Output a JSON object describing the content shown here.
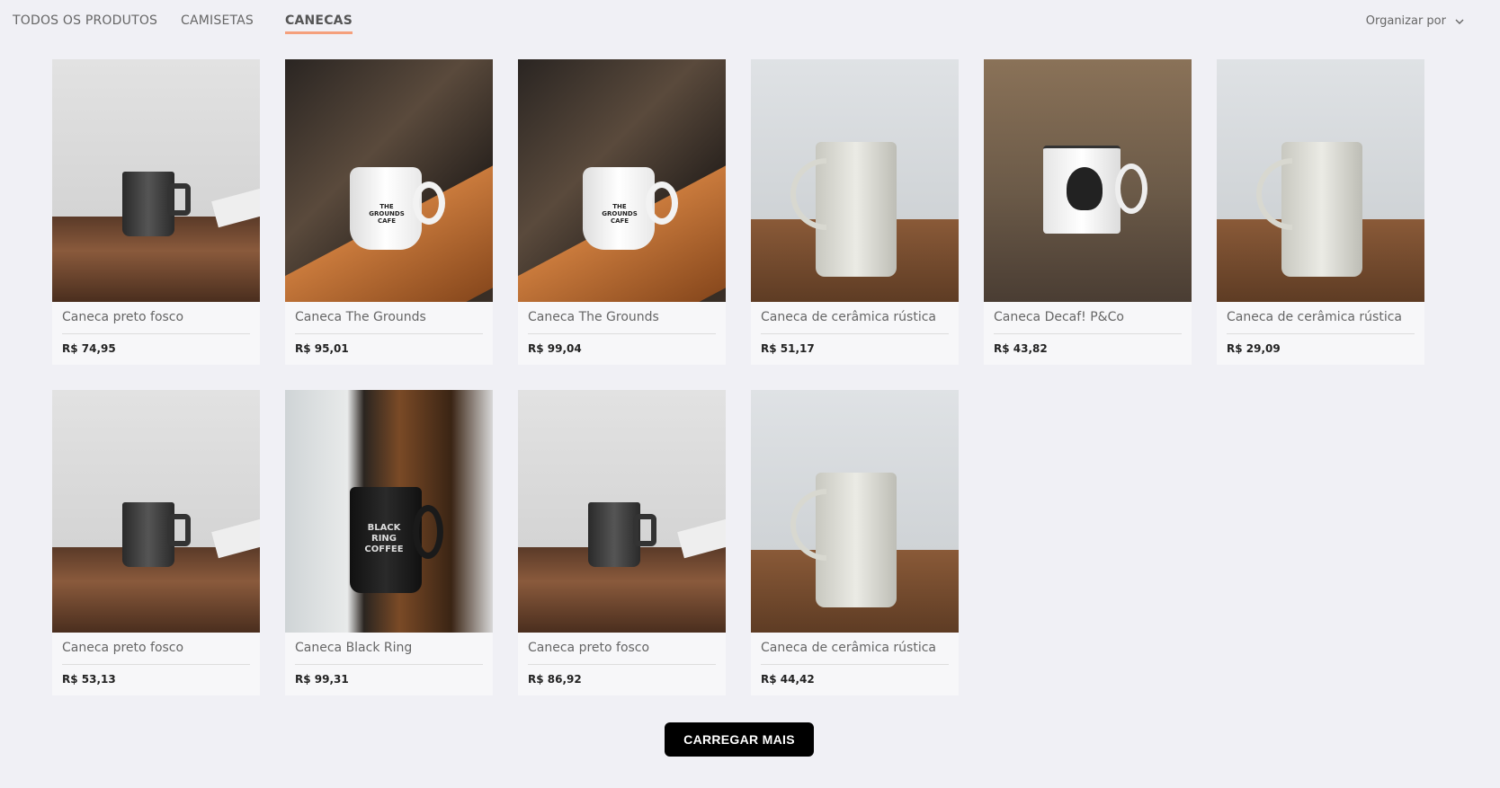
{
  "nav": {
    "tabs": [
      {
        "label": "TODOS OS PRODUTOS",
        "active": false
      },
      {
        "label": "CAMISETAS",
        "active": false
      },
      {
        "label": "CANECAS",
        "active": true
      }
    ],
    "sort_label": "Organizar por",
    "sort_icon": "chevron-down-icon"
  },
  "products": [
    {
      "name": "Caneca preto fosco",
      "price": "R$ 74,95",
      "image": "matte-black-mug"
    },
    {
      "name": "Caneca The Grounds",
      "price": "R$ 95,01",
      "image": "grounds-cafe-mug",
      "image_text": "THE GROUNDS CAFE"
    },
    {
      "name": "Caneca The Grounds",
      "price": "R$ 99,04",
      "image": "grounds-cafe-mug",
      "image_text": "THE GROUNDS CAFE"
    },
    {
      "name": "Caneca de cerâmica rústica",
      "price": "R$ 51,17",
      "image": "rustic-ceramic-mug"
    },
    {
      "name": "Caneca Decaf! P&Co",
      "price": "R$ 43,82",
      "image": "decaf-skull-mug"
    },
    {
      "name": "Caneca de cerâmica rústica",
      "price": "R$ 29,09",
      "image": "rustic-ceramic-mug"
    },
    {
      "name": "Caneca preto fosco",
      "price": "R$ 53,13",
      "image": "matte-black-mug"
    },
    {
      "name": "Caneca Black Ring",
      "price": "R$ 99,31",
      "image": "black-ring-mug",
      "image_text": "BLACK RING COFFEE"
    },
    {
      "name": "Caneca preto fosco",
      "price": "R$ 86,92",
      "image": "matte-black-mug"
    },
    {
      "name": "Caneca de cerâmica rústica",
      "price": "R$ 44,42",
      "image": "rustic-ceramic-mug"
    }
  ],
  "load_more_label": "CARREGAR MAIS",
  "colors": {
    "background": "#f0f0f5",
    "active_tab_underline": "#f5a07c",
    "button": "#000000"
  }
}
